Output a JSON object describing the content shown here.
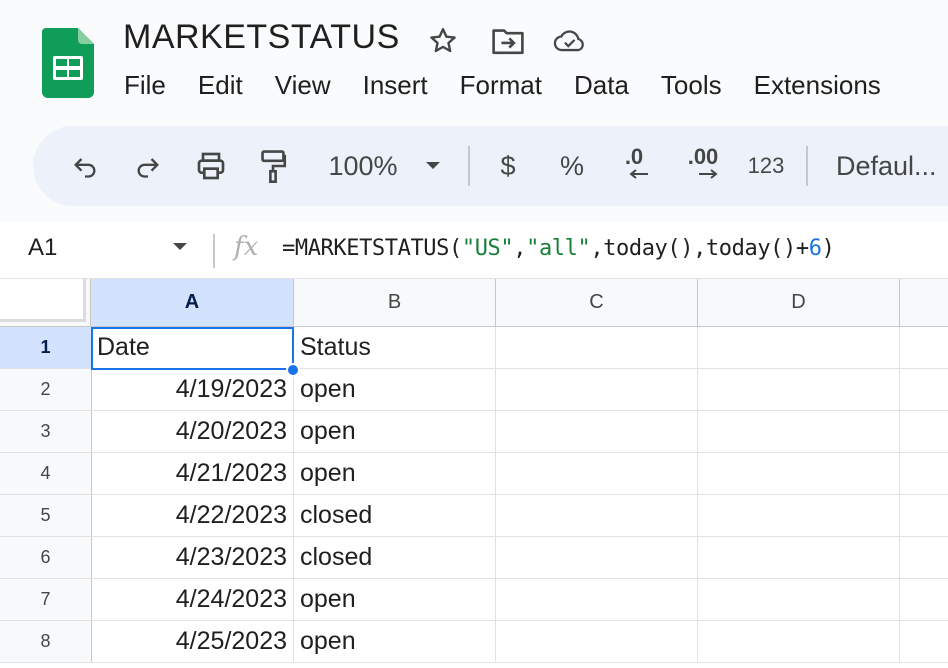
{
  "title": "MARKETSTATUS",
  "menu": [
    "File",
    "Edit",
    "View",
    "Insert",
    "Format",
    "Data",
    "Tools",
    "Extensions"
  ],
  "toolbar": {
    "zoom": "100%",
    "currency": "$",
    "percent": "%",
    "decrease_decimals": ".0",
    "increase_decimals": ".00",
    "number_format": "123",
    "font": "Defaul..."
  },
  "formula_bar": {
    "cell_ref": "A1",
    "fx": "fx",
    "formula_parts": {
      "p1": "=MARKETSTATUS(",
      "s1": "\"US\"",
      "p2": ",",
      "s2": "\"all\"",
      "p3": ",today(),today()+",
      "n1": "6",
      "p4": ")"
    }
  },
  "columns": [
    "A",
    "B",
    "C",
    "D"
  ],
  "rows": [
    {
      "num": "1",
      "a": "Date",
      "b": "Status"
    },
    {
      "num": "2",
      "a": "4/19/2023",
      "b": "open"
    },
    {
      "num": "3",
      "a": "4/20/2023",
      "b": "open"
    },
    {
      "num": "4",
      "a": "4/21/2023",
      "b": "open"
    },
    {
      "num": "5",
      "a": "4/22/2023",
      "b": "closed"
    },
    {
      "num": "6",
      "a": "4/23/2023",
      "b": "closed"
    },
    {
      "num": "7",
      "a": "4/24/2023",
      "b": "open"
    },
    {
      "num": "8",
      "a": "4/25/2023",
      "b": "open"
    }
  ],
  "colors": {
    "accent": "#1a73e8",
    "logo_green": "#0f9d58",
    "selection_header": "#d3e3fd",
    "string_green": "#188038"
  },
  "icons": [
    "sheets-logo-icon",
    "star-icon",
    "move-to-folder-icon",
    "cloud-saved-icon",
    "undo-icon",
    "redo-icon",
    "print-icon",
    "paint-format-icon",
    "chevron-down-icon"
  ]
}
